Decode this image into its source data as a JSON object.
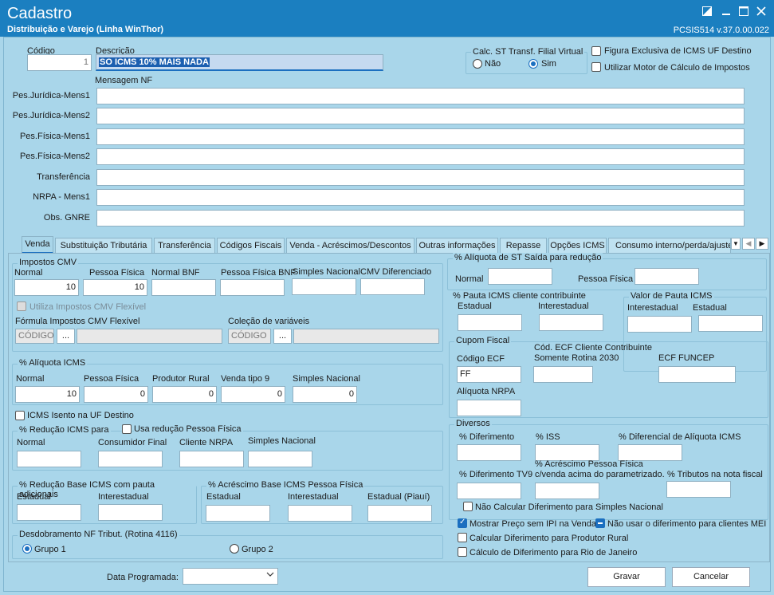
{
  "window": {
    "title": "Cadastro",
    "subtitle": "Distribuição e Varejo (Linha WinThor)",
    "version": "PCSIS514  v.37.0.00.022"
  },
  "header": {
    "codigo_label": "Código",
    "codigo_value": "1",
    "descricao_label": "Descrição",
    "descricao_value": "SO ICMS 10% MAIS NADA",
    "calc_st_label": "Calc. ST Transf. Filial Virtual",
    "radio_nao": "Não",
    "radio_sim": "Sim",
    "figura_exclusiva": "Figura Exclusiva de ICMS UF Destino",
    "utilizar_motor": "Utilizar Motor de Cálculo de Impostos",
    "mensagem_nf": "Mensagem NF"
  },
  "messages": [
    {
      "label": "Pes.Jurídica-Mens1",
      "value": ""
    },
    {
      "label": "Pes.Jurídica-Mens2",
      "value": ""
    },
    {
      "label": "Pes.Física-Mens1",
      "value": ""
    },
    {
      "label": "Pes.Física-Mens2",
      "value": ""
    },
    {
      "label": "Transferência",
      "value": ""
    },
    {
      "label": "NRPA - Mens1",
      "value": ""
    },
    {
      "label": "Obs. GNRE",
      "value": ""
    }
  ],
  "tabs": [
    "Venda",
    "Substituição Tributária",
    "Transferência",
    "Códigos Fiscais",
    "Venda - Acréscimos/Descontos",
    "Outras informações",
    "Repasse",
    "Opções ICMS",
    "Consumo interno/perda/ajuste"
  ],
  "left": {
    "impostos_cmv": "Impostos CMV",
    "cmv_labels": [
      "Normal",
      "Pessoa Física",
      "Normal BNF",
      "Pessoa Física BNF",
      "Simples Nacional",
      "CMV Diferenciado"
    ],
    "cmv_values": [
      "10",
      "10",
      "",
      "",
      "",
      ""
    ],
    "utiliza_flexivel": "Utiliza Impostos CMV Flexível",
    "formula_label": "Fórmula Impostos CMV Flexível",
    "colecao_label": "Coleção de variáveis",
    "codigo_placeholder": "CÓDIGO",
    "dots": "...",
    "aliquota_icms": "% Alíquota ICMS",
    "aliq_labels": [
      "Normal",
      "Pessoa Física",
      "Produtor Rural",
      "Venda tipo 9",
      "Simples Nacional"
    ],
    "aliq_values": [
      "10",
      "0",
      "0",
      "0",
      "0"
    ],
    "icms_isento": "ICMS Isento na UF Destino",
    "reducao_icms": "% Redução ICMS para",
    "usa_reducao_pf": "Usa redução Pessoa Física",
    "reducao_labels": [
      "Normal",
      "Consumidor Final",
      "Cliente NRPA",
      "Simples Nacional"
    ],
    "reducao_base": "% Redução Base ICMS com pauta adicionais",
    "reducao_base_labels": [
      "Estadual",
      "Interestadual"
    ],
    "acrescimo_base": "% Acréscimo Base ICMS Pessoa Física",
    "acrescimo_labels": [
      "Estadual",
      "Interestadual",
      "Estadual (Piauí)"
    ],
    "desdobramento": "Desdobramento NF Tribut. (Rotina 4116)",
    "grupo1": "Grupo 1",
    "grupo2": "Grupo 2"
  },
  "right": {
    "aliq_st_saida": "% Alíquota de ST Saída para redução",
    "st_labels": [
      "Normal",
      "Pessoa Física"
    ],
    "pauta_icms": "% Pauta ICMS cliente contribuinte",
    "pauta_labels": [
      "Estadual",
      "Interestadual"
    ],
    "valor_pauta": "Valor de Pauta ICMS",
    "valor_pauta_labels": [
      "Interestadual",
      "Estadual"
    ],
    "cupom_fiscal": "Cupom Fiscal",
    "codigo_ecf": "Código ECF",
    "codigo_ecf_value": "FF",
    "cod_ecf_cliente_1": "Cód. ECF Cliente Contribuinte",
    "cod_ecf_cliente_2": "Somente Rotina 2030",
    "ecf_funcep": "ECF FUNCEP",
    "aliquota_nrpa": "Alíquota NRPA",
    "diversos": "Diversos",
    "diferimento": "% Diferimento",
    "iss": "% ISS",
    "diferencial_aliq": "% Diferencial de Alíquota ICMS",
    "diferimento_tv9": "% Diferimento TV9",
    "acrescimo_pf_1": "% Acréscimo Pessoa Física",
    "acrescimo_pf_2": "c/venda acima do parametrizado.",
    "tributos_nota": "% Tributos na nota fiscal",
    "nao_calcular_dif": "Não Calcular Diferimento para Simples Nacional",
    "mostrar_preco": "Mostrar Preço sem IPI na Venda",
    "nao_usar_dif": "Não usar o diferimento para clientes MEI",
    "calc_dif_rural": "Calcular Diferimento para Produtor Rural",
    "calc_dif_rj": "Cálculo de Diferimento para Rio de Janeiro"
  },
  "footer": {
    "data_programada": "Data Programada:",
    "gravar": "Gravar",
    "cancelar": "Cancelar"
  }
}
